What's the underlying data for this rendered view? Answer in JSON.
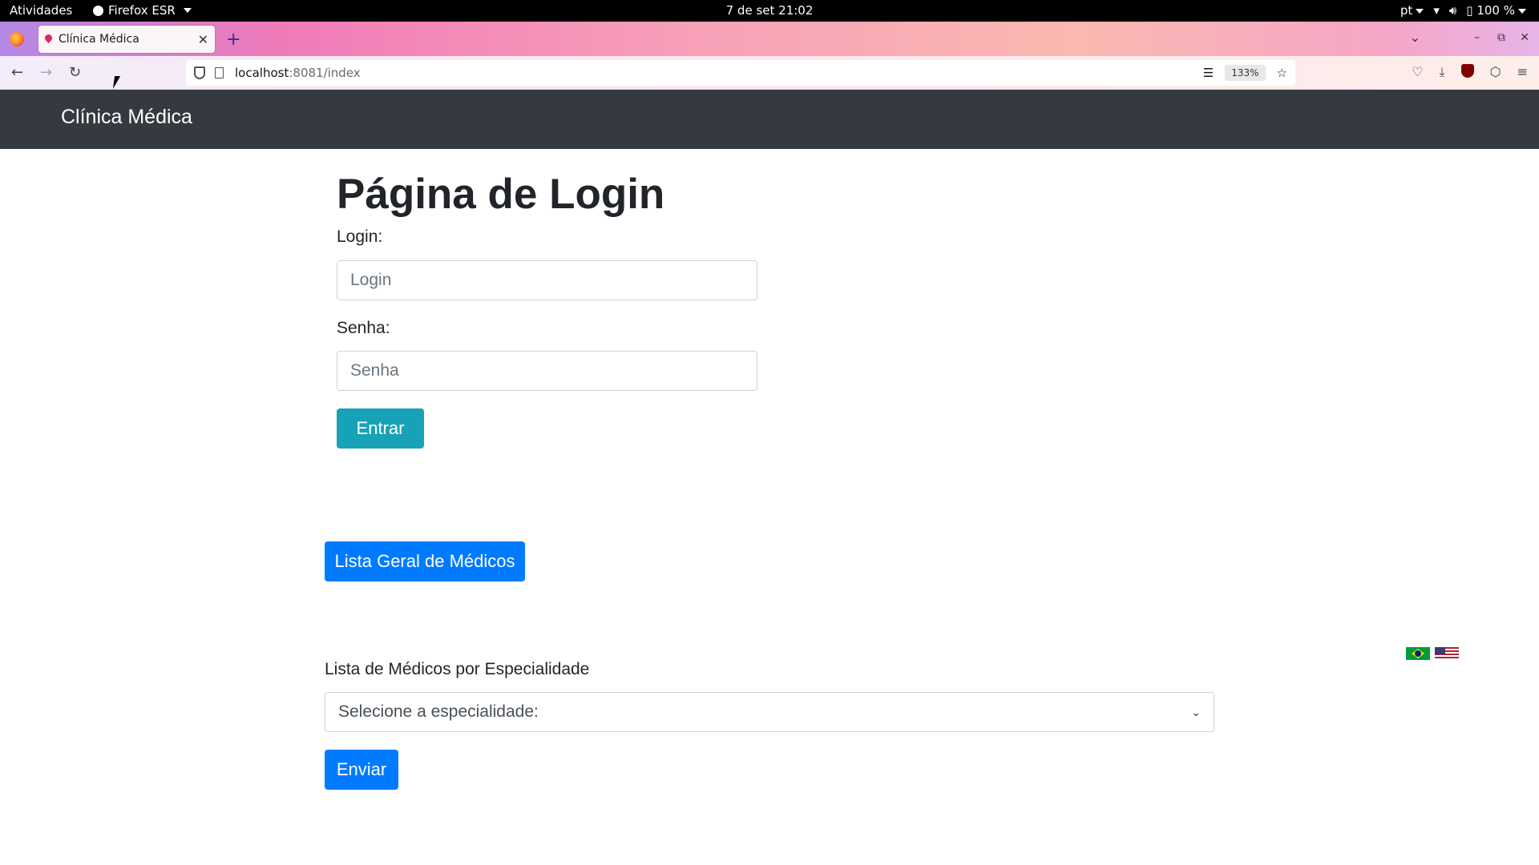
{
  "system_bar": {
    "activities": "Atividades",
    "app_name": "Firefox ESR",
    "clock": "7 de set  21:02",
    "language": "pt",
    "battery": "100 %"
  },
  "browser": {
    "tab_title": "Clínica Médica",
    "url_host": "localhost",
    "url_path": ":8081/index",
    "zoom": "133%",
    "icons": {
      "back": "back-arrow-icon",
      "forward": "forward-arrow-icon",
      "reload": "reload-icon",
      "reader": "reader-view-icon",
      "bookmark": "star-icon",
      "pocket": "pocket-icon",
      "downloads": "download-icon",
      "ublock": "ublock-icon",
      "extensions": "extensions-icon",
      "menu": "hamburger-menu-icon"
    }
  },
  "site": {
    "brand": "Clínica Médica"
  },
  "login": {
    "heading": "Página de Login",
    "login_label": "Login:",
    "login_placeholder": "Login",
    "password_label": "Senha:",
    "password_placeholder": "Senha",
    "submit_label": "Entrar"
  },
  "doctors": {
    "list_all_label": "Lista Geral de Médicos",
    "by_specialty_label": "Lista de Médicos por Especialidade",
    "specialty_select_value": "Selecione a especialidade:",
    "send_label": "Enviar"
  },
  "languages": [
    "pt-BR",
    "en-US"
  ],
  "colors": {
    "navbar": "#343a40",
    "btn_info": "#17a2b8",
    "btn_primary": "#007bff"
  }
}
